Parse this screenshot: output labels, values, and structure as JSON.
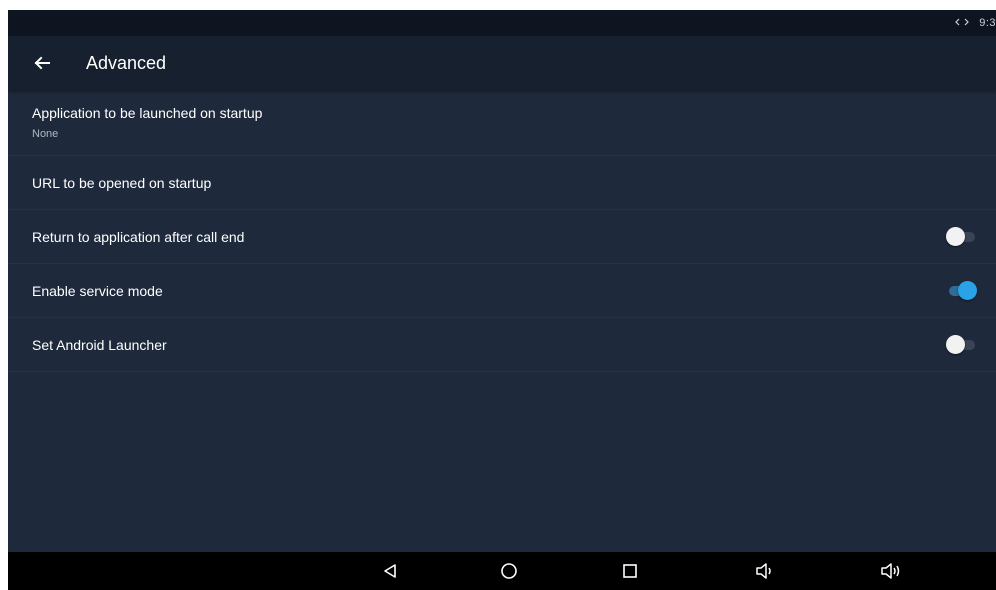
{
  "status_bar": {
    "sync_icon": "arrows-sync-icon",
    "time": "9:3"
  },
  "app_bar": {
    "back_icon": "arrow-left-icon",
    "title": "Advanced"
  },
  "settings": [
    {
      "title": "Application to be launched on startup",
      "summary": "None"
    },
    {
      "title": "URL to be opened on startup"
    },
    {
      "title": "Return to application after call end",
      "switch_on": false
    },
    {
      "title": "Enable service mode",
      "switch_on": true
    },
    {
      "title": "Set Android Launcher",
      "switch_on": false
    }
  ],
  "nav_bar": {
    "icons": [
      "back-triangle-icon",
      "home-circle-icon",
      "recents-square-icon",
      "volume-down-icon",
      "volume-up-icon"
    ]
  },
  "colors": {
    "background": "#1e2a3c",
    "app_bar": "#17202e",
    "status_bar": "#0f1520",
    "accent": "#29a3e6",
    "nav_bar": "#000000"
  }
}
